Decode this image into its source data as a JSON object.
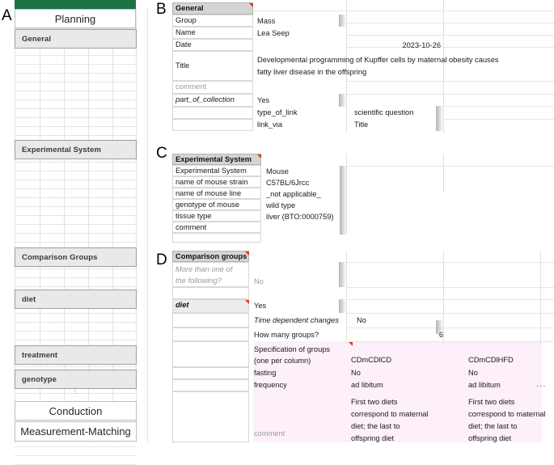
{
  "panels": {
    "a": {
      "letter": "A",
      "title": "Planning",
      "green_bar_color": "#1d7244",
      "tabs": [
        {
          "label": "General"
        },
        {
          "label": "Experimental System"
        },
        {
          "label": "Comparison Groups"
        },
        {
          "label": "diet"
        },
        {
          "label": "treatment"
        },
        {
          "label": "genotype"
        }
      ],
      "ellipsis": "⋮",
      "footer_tabs": [
        {
          "label": "Conduction"
        },
        {
          "label": "Measurement-Matching"
        }
      ]
    },
    "b": {
      "letter": "B",
      "header": "General",
      "rows": [
        {
          "key": "Group",
          "value": "Mass"
        },
        {
          "key": "Name",
          "value": "Lea Seep"
        },
        {
          "key": "Date",
          "value": "2023-10-26"
        },
        {
          "key": "Title",
          "value": "Developmental programming of Kupffer cells by maternal obesity causes\nfatty liver disease in the offspring"
        },
        {
          "key": "comment",
          "value": ""
        },
        {
          "key": "part_of_collection",
          "value": "Yes"
        }
      ],
      "sub_rows": [
        {
          "key": "type_of_link",
          "value": "scientific question"
        },
        {
          "key": "link_via",
          "value": "Title"
        }
      ]
    },
    "c": {
      "letter": "C",
      "header": "Experimental System",
      "rows": [
        {
          "key": "Experimental System",
          "value": "Mouse"
        },
        {
          "key": "name of mouse strain",
          "value": "C57BL/6Jrcc"
        },
        {
          "key": "name of mouse line",
          "value": "_not applicable_"
        },
        {
          "key": "genotype of mouse",
          "value": "wild type"
        },
        {
          "key": "tissue type",
          "value": "liver (BTO:0000759)"
        },
        {
          "key": "comment",
          "value": ""
        }
      ]
    },
    "d": {
      "letter": "D",
      "header": "Comparison groups",
      "more_than_one_label": "More than one of\nthe following?",
      "more_than_one_value": "No",
      "diet_label": "diet",
      "diet_value": "Yes",
      "sub_rows": [
        {
          "key": "Time dependent changes",
          "value": "No",
          "italic": true
        },
        {
          "key": "How many groups?",
          "value": "6",
          "italic": false
        }
      ],
      "spec_label": "Specification of groups\n(one per column)",
      "group_columns": [
        "CDmCDlCD",
        "CDmCDlHFD"
      ],
      "detail_rows": [
        {
          "key": "fasting",
          "values": [
            "No",
            "No"
          ]
        },
        {
          "key": "frequency",
          "values": [
            "ad libitum",
            "ad libitum"
          ]
        }
      ],
      "comment_label": "comment",
      "comment_values": [
        "First two diets\ncorrespond to maternal\ndiet; the last to\noffspring diet",
        "First two diets\ncorrespond to maternal\ndiet; the last to\noffspring diet"
      ],
      "overflow_dots": "...",
      "highlight_color": "#fdf0fa"
    }
  }
}
